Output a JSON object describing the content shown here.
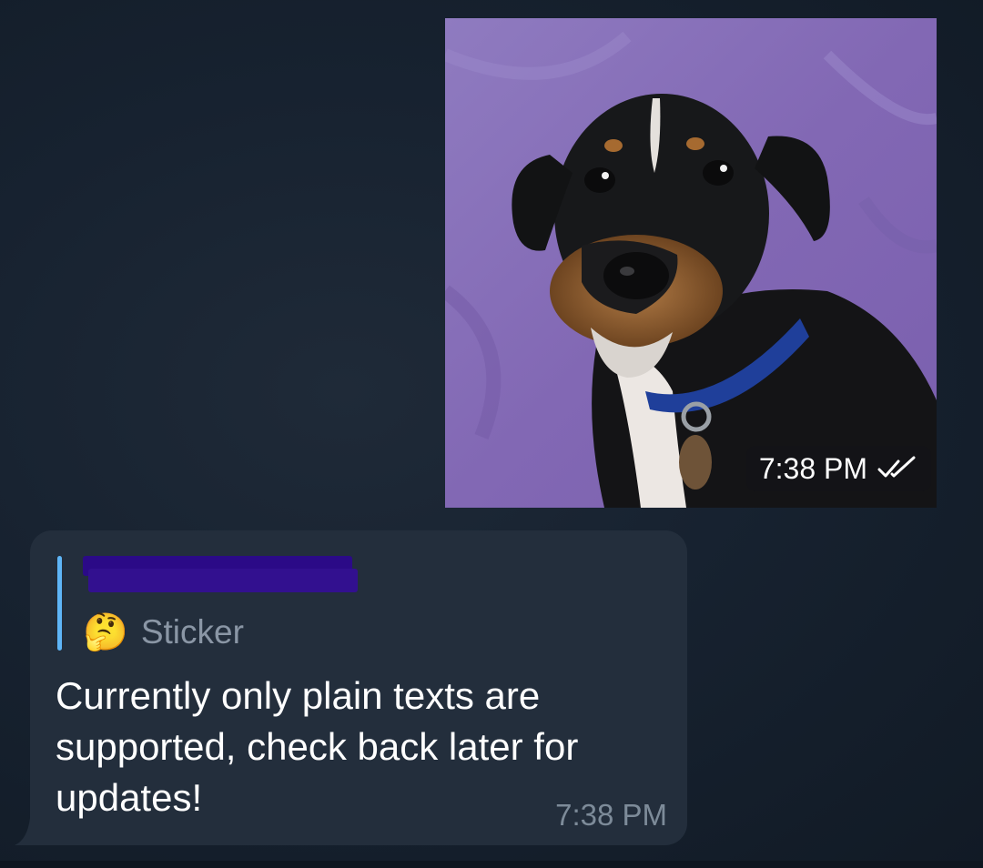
{
  "sticker_message": {
    "time": "7:38 PM",
    "status_icon": "double-check-icon",
    "colors": {
      "background": "#8a74b8",
      "time_pill": "#141418"
    }
  },
  "reply_message": {
    "quoted": {
      "author": "",
      "emoji": "🤔",
      "type_label": "Sticker",
      "accent_color": "#5eb5f7"
    },
    "text": "Currently only plain texts are supported, check back later for updates!",
    "time": "7:38 PM",
    "bubble_color": "#232e3c"
  }
}
